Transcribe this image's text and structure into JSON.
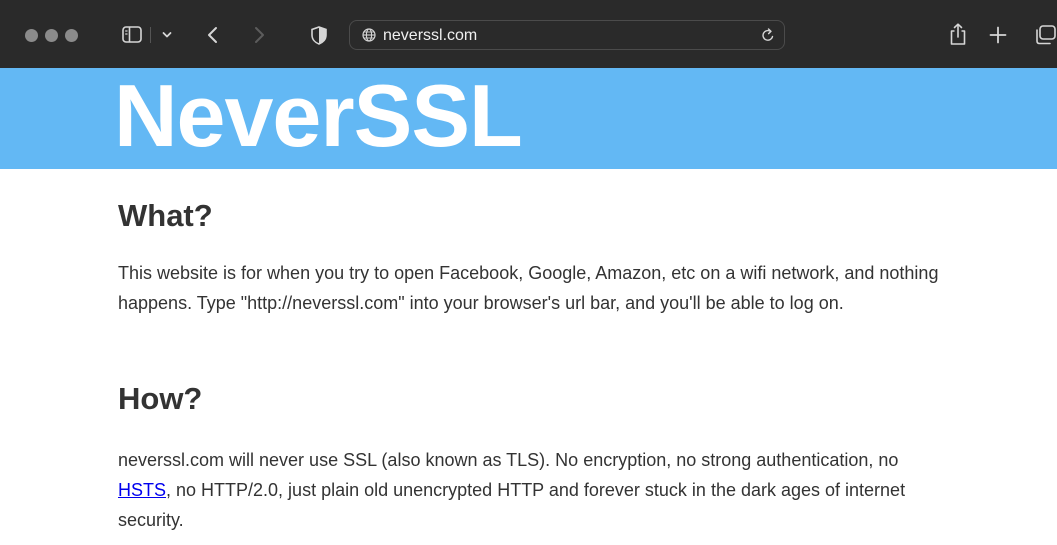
{
  "browser": {
    "address": "neverssl.com",
    "icons": {
      "close": "traffic-light",
      "minimize": "traffic-light",
      "zoom": "traffic-light",
      "sidebar": "sidebar-icon",
      "sidebar_menu": "chevron-down-icon",
      "back": "chevron-left-icon",
      "forward": "chevron-right-icon",
      "privacy": "shield-icon",
      "site": "globe-icon",
      "reload": "reload-icon",
      "share": "share-icon",
      "new_tab": "plus-icon",
      "tabs": "tabs-icon"
    }
  },
  "page": {
    "title": "NeverSSL",
    "sections": [
      {
        "heading": "What?",
        "body": "This website is for when you try to open Facebook, Google, Amazon, etc on a wifi network, and nothing happens. Type \"http://neverssl.com\" into your browser's url bar, and you'll be able to log on."
      },
      {
        "heading": "How?",
        "body_before_link": "neverssl.com will never use SSL (also known as TLS). No encryption, no strong authentication, no ",
        "link": "HSTS",
        "body_after_link": ", no HTTP/2.0, just plain old unencrypted HTTP and forever stuck in the dark ages of internet security."
      }
    ]
  },
  "colors": {
    "toolbar": "#2a2a2a",
    "header": "#63b8f4",
    "link": "#0000ee",
    "text": "#333333"
  }
}
